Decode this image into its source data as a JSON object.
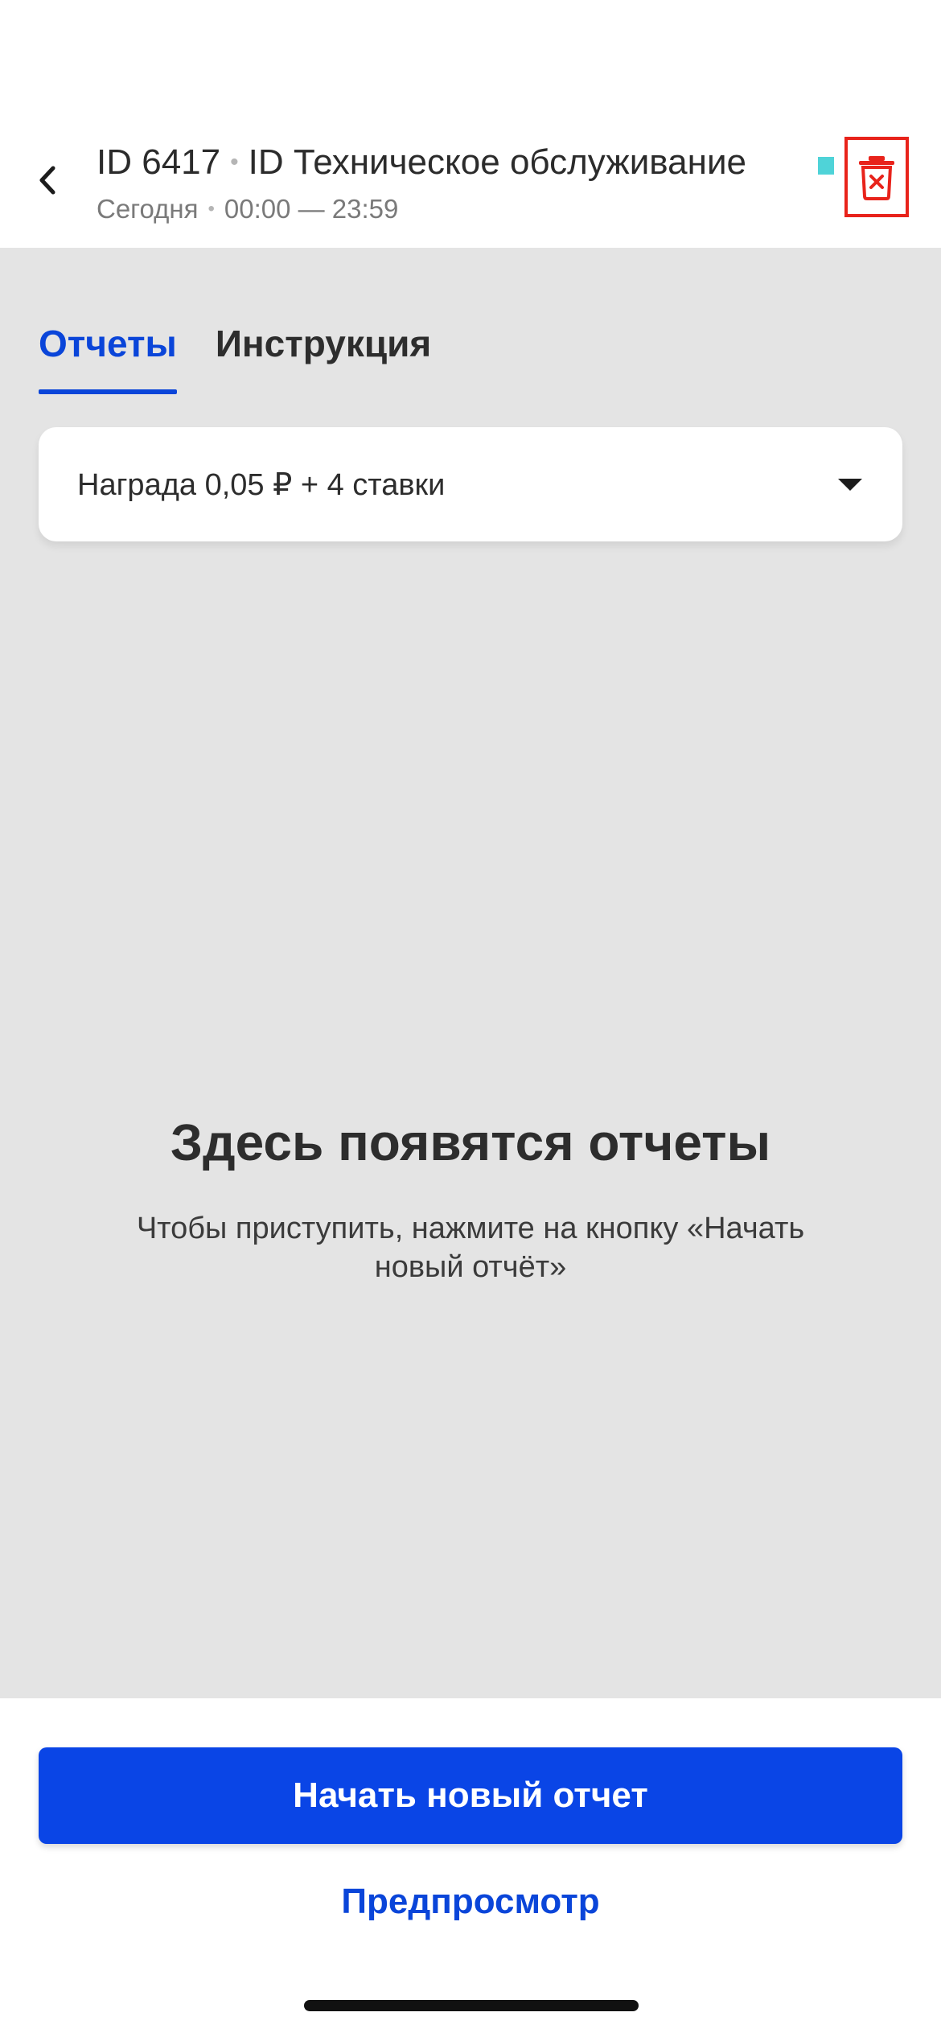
{
  "header": {
    "back_icon": "chevron-left-icon",
    "id_label": "ID 6417",
    "task_title": "ID Техническое обслуживание",
    "separator": "•",
    "date_label": "Сегодня",
    "time_range": "00:00 — 23:59",
    "status_color": "#4fd3d8",
    "delete_icon": "trash-x-icon",
    "delete_highlight_color": "#e8231b"
  },
  "tabs": [
    {
      "label": "Отчеты",
      "active": true
    },
    {
      "label": "Инструкция",
      "active": false
    }
  ],
  "reward": {
    "label": "Награда 0,05 ₽ + 4 ставки",
    "icon": "caret-down-icon"
  },
  "empty_state": {
    "title": "Здесь появятся отчеты",
    "description": "Чтобы приступить, нажмите на кнопку «Начать новый отчёт»"
  },
  "actions": {
    "primary_label": "Начать новый отчет",
    "secondary_label": "Предпросмотр"
  },
  "colors": {
    "accent": "#0a45d9",
    "primary_button": "#0a45e6",
    "content_background": "#e4e4e4"
  }
}
